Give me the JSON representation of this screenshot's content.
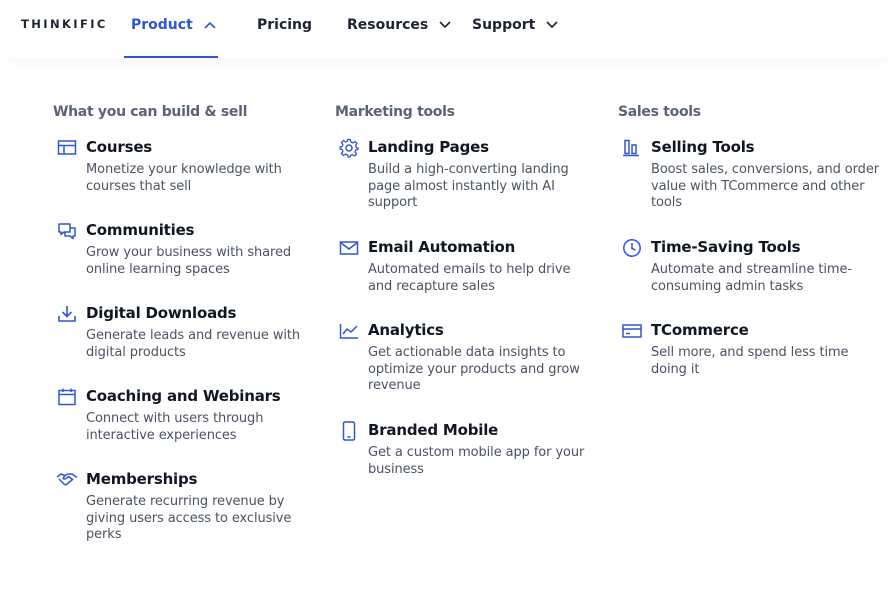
{
  "logo": "THINKIFIC",
  "nav": {
    "product": "Product",
    "pricing": "Pricing",
    "resources": "Resources",
    "support": "Support"
  },
  "colors": {
    "accent": "#3056d3",
    "text": "#111722",
    "muted": "#4a5363"
  },
  "columns": [
    {
      "title": "What you can build & sell",
      "items": [
        {
          "icon": "courses-icon",
          "title": "Courses",
          "desc": "Monetize your knowledge with courses that sell"
        },
        {
          "icon": "communities-icon",
          "title": "Communities",
          "desc": "Grow your business with shared online learning spaces"
        },
        {
          "icon": "download-icon",
          "title": "Digital Downloads",
          "desc": "Generate leads and revenue with digital products"
        },
        {
          "icon": "calendar-icon",
          "title": "Coaching and Webinars",
          "desc": "Connect with users through interactive experiences"
        },
        {
          "icon": "handshake-icon",
          "title": "Memberships",
          "desc": "Generate recurring revenue by giving users access to exclusive perks"
        }
      ]
    },
    {
      "title": "Marketing tools",
      "items": [
        {
          "icon": "gear-icon",
          "title": "Landing Pages",
          "desc": "Build a high-converting landing page almost instantly with AI support"
        },
        {
          "icon": "mail-icon",
          "title": "Email Automation",
          "desc": "Automated emails to help drive and recapture sales"
        },
        {
          "icon": "line-chart-icon",
          "title": "Analytics",
          "desc": "Get actionable data insights to optimize your products and grow revenue"
        },
        {
          "icon": "mobile-icon",
          "title": "Branded Mobile",
          "desc": "Get a custom mobile app for your business"
        }
      ]
    },
    {
      "title": "Sales tools",
      "items": [
        {
          "icon": "bar-chart-icon",
          "title": "Selling Tools",
          "desc": "Boost sales, conversions, and order value with TCommerce and other tools"
        },
        {
          "icon": "clock-icon",
          "title": "Time-Saving Tools",
          "desc": "Automate and streamline time-consuming admin tasks"
        },
        {
          "icon": "credit-card-icon",
          "title": "TCommerce",
          "desc": "Sell more, and spend less time doing it"
        }
      ]
    }
  ]
}
